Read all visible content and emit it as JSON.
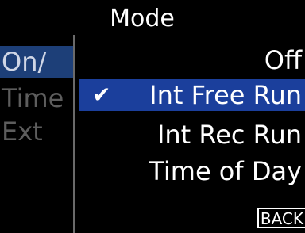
{
  "popup": {
    "title": "Mode",
    "options": [
      {
        "label": "Off",
        "selected": false
      },
      {
        "label": "Int Free Run",
        "selected": true
      },
      {
        "label": "Int Rec Run",
        "selected": false
      },
      {
        "label": "Time of Day",
        "selected": false
      }
    ],
    "check_glyph": "✔",
    "back_label": "BACK"
  },
  "background_menu": {
    "items": [
      {
        "label": "On/",
        "state": "selected"
      },
      {
        "label": "Time",
        "state": "dim"
      },
      {
        "label": "Ext",
        "state": "dim"
      }
    ]
  },
  "colors": {
    "highlight": "#1b3f9c",
    "bg_selected": "#1d3f78",
    "dim_text": "#5d5d5d",
    "background": "#000000",
    "text": "#ffffff"
  }
}
